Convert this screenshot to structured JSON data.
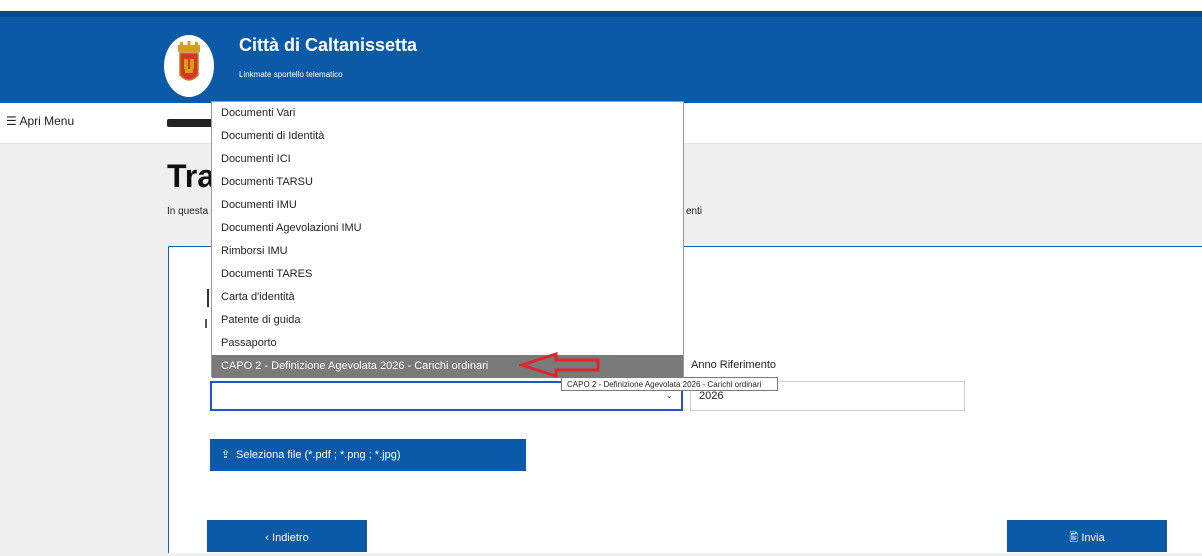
{
  "header": {
    "title": "Città di Caltanissetta",
    "subtitle": "Linkmate sportello telematico",
    "colors": {
      "primary": "#0b5aa8",
      "dark": "#064a8c"
    }
  },
  "nav": {
    "menu_icon": "hamburger-icon",
    "menu_glyph": "☰",
    "menu_label": "Apri Menu"
  },
  "page": {
    "title_visible": "Tra",
    "intro_visible_start": "In questa",
    "intro_visible_end": "enti"
  },
  "dropdown": {
    "items": [
      "Documenti Vari",
      "Documenti di Identità",
      "Documenti ICI",
      "Documenti TARSU",
      "Documenti IMU",
      "Documenti Agevolazioni IMU",
      "Rimborsi IMU",
      "Documenti TARES",
      "Carta d'identità",
      "Patente di guida",
      "Passaporto",
      "CAPO 2 - Definizione Agevolata 2026 - Carichi ordinari"
    ],
    "selected_index": 11,
    "tooltip": "CAPO 2 - Definizione Agevolata 2026 - Carichi ordinari",
    "highlight_color": "#7a7a7a",
    "annotation_color": "#e0242c"
  },
  "form": {
    "select_chevron": "⌄",
    "year_label": "Anno Riferimento",
    "year_value": "2026",
    "upload_icon": "upload-icon",
    "upload_glyph": "⇪",
    "upload_label": "Seleziona file (*.pdf ; *.png ; *.jpg)"
  },
  "footer_buttons": {
    "back_glyph": "‹",
    "back_label": "Indietro",
    "send_icon": "file-icon",
    "send_glyph": "🖺",
    "send_label": "Invia"
  }
}
